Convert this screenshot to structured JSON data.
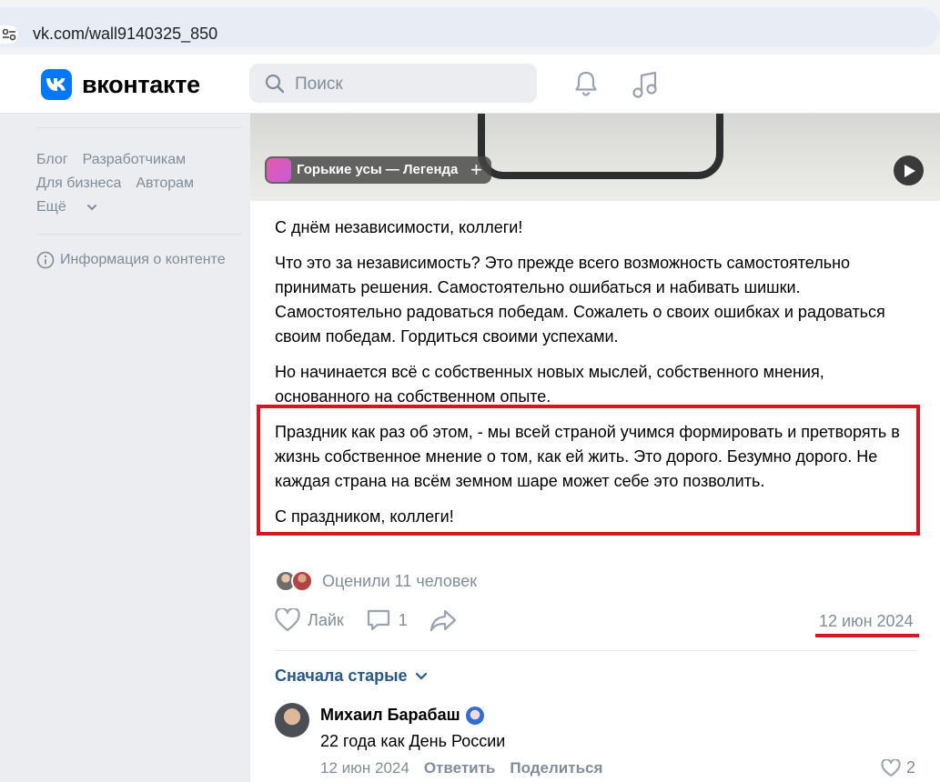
{
  "browser": {
    "url": "vk.com/wall9140325_850"
  },
  "header": {
    "brand": "вконтакте",
    "search_placeholder": "Поиск"
  },
  "sidebar": {
    "links_row1": [
      "Блог",
      "Разработчикам"
    ],
    "links_row2": [
      "Для бизнеса",
      "Авторам"
    ],
    "more": "Ещё",
    "info": "Информация о контенте"
  },
  "post": {
    "music": {
      "title": "Горькие усы — Легенда"
    },
    "paragraphs": [
      "С днём независимости, коллеги!",
      "Что это за независимость? Это прежде всего возможность самостоятельно принимать решения. Самостоятельно ошибаться и набивать шишки. Самостоятельно радоваться победам. Сожалеть о своих ошибках и радоваться своим победам. Гордиться своими успехами.",
      "Но начинается всё с собственных новых мыслей, собственного мнения, основанного на собственном опыте.",
      "Праздник как раз об этом, - мы всей страной учимся формировать и претворять в жизнь собственное мнение о том, как ей жить. Это дорого. Безумно дорого. Не каждая страна на всём земном шаре может себе это позволить.",
      "С праздником, коллеги!"
    ],
    "liked_text": "Оценили 11 человек",
    "like_label": "Лайк",
    "comments_count": "1",
    "date": "12 июн 2024",
    "sort_label": "Сначала старые"
  },
  "comment": {
    "author": "Михаил Барабаш",
    "text": "22 года как День России",
    "date": "12 июн 2024",
    "reply": "Ответить",
    "share": "Поделиться",
    "likes": "2"
  },
  "colors": {
    "vk_blue": "#0077ff",
    "highlight_red": "#d9131f",
    "muted": "#818c99",
    "link": "#2a5885"
  }
}
